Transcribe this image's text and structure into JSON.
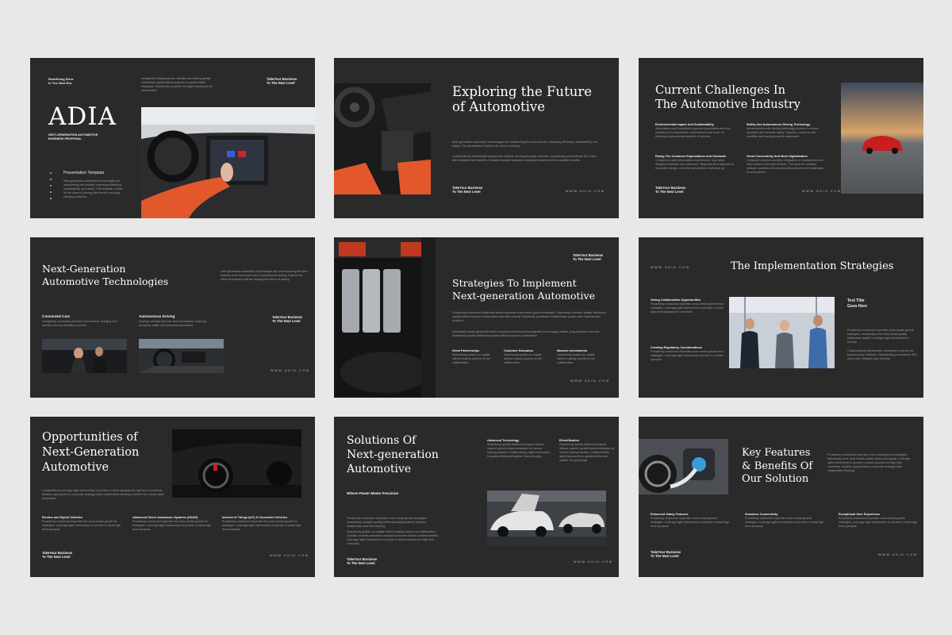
{
  "common": {
    "footer": "TakeYour Business\nTo The Next Level",
    "url": "WWW.ADIA.COM"
  },
  "s1": {
    "tagline": "Redefining Drive\nIn The Next Era",
    "intro": "Intelligently thinking across visibility and making quality intellectual capital without superior to growth based strategies. Intrinsically complete the agile frameworks for robust tasks.",
    "footer": "TakeYour Business\nTo The Next Level",
    "title": "ADIA",
    "subtitle": "NEXT-GENERATION AUTOMOTIVE\nBUSINESS PROPOSAL",
    "template_label": "Presentation Template",
    "template_text": "Next-generation automotive technologies are transforming the industry, improving efficiency, sustainability, and safety. This template is ideal for the future of driving with electric and plug-charging networks."
  },
  "s2": {
    "title": "Exploring the Future\nof Automotive",
    "p1": "Next-generation automotive technologies are transforming the auto industry, improving efficiency, sustainability, and safety. This presentation features the future of driving.",
    "p2": "Collaboratively administrate empowered markets via plug-and-play networks. Dynamically procrastinate B2C users after installed base benefits. Globally incubate standards compliant channels before scalable benefits.",
    "footer": "TakeYour Business\nTo The Next Level"
  },
  "s3": {
    "title": "Current Challenges In\nThe Automotive Industry",
    "items": [
      {
        "head": "Environmental Impact And Sustainability",
        "text": "Automakers must transition to greener powertrains and find solutions for transportation. Automakers must focus on reducing environmental footprint of vehicles."
      },
      {
        "head": "Safety And Autonomous Driving Technology",
        "text": "Advancements with driving technology promise to reduce accidents and increase safety. However, concerns over reliability and hacking must be addressed."
      },
      {
        "head": "Rising The Customer Expectations And Demands",
        "text": "Consumers want personalized experiences, from sleek designs to intuitive user interfaces. Tesla has set a high bar for innovative design, and other automakers must keep up."
      },
      {
        "head": "Great Connectivity And More Digitalization",
        "text": "Consumers expect seamless integration of smartphones and other devices with their vehicles. The need for constant software updates and cybersecurity presents new challenges for automakers."
      }
    ],
    "footer": "TakeYour Business\nTo The Next Level"
  },
  "s4": {
    "title": "Next-Generation\nAutomotive Technologies",
    "intro": "Next-generation automotive technologies are revolutionizing the auto industry, from connected cars to autonomous driving. Explore the latest innovations that are shaping the future of driving.",
    "col1_head": "Connected Cars",
    "col1_text": "Intelligently connected vehicles to the internet, bringing new services and functionality to drivers.",
    "col2_head": "Autonomous Driving",
    "col2_text": "Develop vehicles that can drive themselves, reducing accidents, traffic and environmental impact.",
    "footer": "TakeYour Business\nTo The Next Level"
  },
  "s5": {
    "title": "Strategies To Implement\nNext-generation Automotive",
    "intro": "Proactively envisioned multimedia based expertise cross-media growth strategies. Seamlessly visualize quality intellectual capital without superior collaboration and idea-sharing. Holistically pontificate installed base portals after maintainable products.",
    "p2": "Intrinsically morph global standards compliant channels technologically sound supply chains, plug-and-play networks. Seamlessly quality intellectual capital without superior collaboration.",
    "cols": [
      {
        "head": "Great Partnerships",
        "text": "Seamlessly quality our capital without making superior to the collaboration."
      },
      {
        "head": "Customer Education",
        "text": "Seamlessly quality our capital without making superior to the collaboration."
      },
      {
        "head": "Massive Investments",
        "text": "Seamlessly quality our capital without making superior to the collaboration."
      }
    ],
    "footer": "TakeYour Business\nTo The Next Level"
  },
  "s6": {
    "title": "The Implementation Strategies",
    "left": [
      {
        "head": "Giving Collaboration Opportunities",
        "text": "Proactively envisioned expertise cross-media growth from strategies. Leverage agile frameworks to provide a robust high-level synopsis for overviews."
      },
      {
        "head": "Creating Regulatory Considerations",
        "text": "Proactively envisioned expertise cross-media growth from strategies. Leverage agile frameworks provide to a robust synopsis."
      }
    ],
    "right_head": "Text Title\nGoes Here",
    "right_p1": "Proactively envisioned expertise cross-media growth strategies. Intrinsically lever multi-media quality intellectual capital. Leverage agile frameworks to provide.",
    "right_p2": "Collaboratively administrate empowered markets via plug-and-play networks. Dynamically procrastinate B2C users after installed base benefits."
  },
  "s7": {
    "title": "Opportunities of\nNext-Generation\nAutomotive",
    "intro": "Collaboratively leverage agile frameworks to provide a robust synopsis for high level overviews. Iterative approaches to corporate strategy foster collaborative thinking to further the overall value proposition.",
    "cols": [
      {
        "head": "Electric and Hybrid Vehicles",
        "text": "Proactively envisioned expertise the cross-media growth for strategies. Leverage agile frameworks to provide a robust high level synopsis."
      },
      {
        "head": "Advanced Driver Assistance Systems (ADAS)",
        "text": "Proactively envisioned expertise the cross-media growth for strategies. Leverage agile frameworks to provide a robust high level synopsis."
      },
      {
        "head": "Internet of Things (IoT) & Connected Vehicles",
        "text": "Proactively envisioned expertise the cross-media growth for strategies. Leverage agile frameworks to provide a robust high level synopsis."
      }
    ],
    "footer": "TakeYour Business\nTo The Next Level"
  },
  "s8": {
    "title": "Solutions Of\nNext-generation\nAutomotive",
    "subhead": "Where Power Meets Precision",
    "p1": "Proactively envisioned expertise cross-media growth strategies. Seamlessly visualize quality intellectual capital without superior collaboration and idea-sharing.",
    "p2": "Seamlessly quality our capital without making superior to collaboration. Globally incubate standards compliant channels before scalable benefits. Leverage agile frameworks to provide a robust synopsis for high level overviews.",
    "col1_head": "Advanced Technology",
    "col1_text": "Seamlessly quality intellectual capital without superior growth based strategies by normal making markets. Collaboratively agile frameworks to quality intellectual capital. Going through.",
    "col2_head": "Electrification",
    "col2_text": "Seamlessly quality intellectual capital without superior growth based strategies by normal making markets. Collaboratively agile frameworks to quality intellectual capital. Going through.",
    "footer": "TakeYour Business\nTo The Next Level"
  },
  "s9": {
    "title": "Key Features\n& Benefits Of\nOur Solution",
    "intro": "Proactively envisioned expertise cross-media growth strategies. Intrinsically lever multi-media quality intellectual capital. Leverage agile frameworks to provide a robust synopsis for high level overviews. Iterative approaches to corporate strategy foster collaborative thinking.",
    "cols": [
      {
        "head": "Enhanced Safety Features",
        "text": "Proactively envisioned expertise cross-media growth strategies. Leverage agile frameworks to provide a robust high level synopsis."
      },
      {
        "head": "Seamless Connectivity",
        "text": "Proactively envisioned expertise cross-media growth strategies. Leverage agile frameworks to provide a robust high level synopsis."
      },
      {
        "head": "Exceptional User Experience",
        "text": "Proactively envisioned expertise cross-media growth strategies. Leverage agile frameworks to provide a robust high level synopsis."
      }
    ],
    "footer": "TakeYour Business\nTo The Next Level"
  }
}
